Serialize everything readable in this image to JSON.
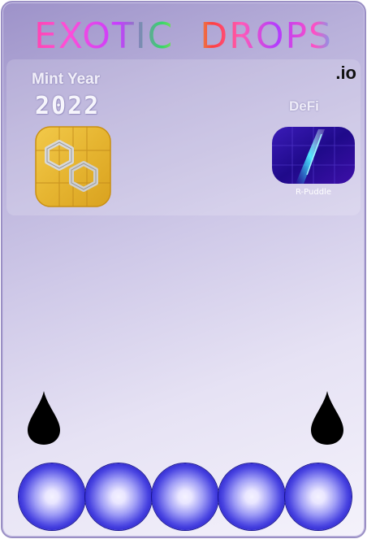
{
  "brand": {
    "title": "EXOTIC  DROPS",
    "tld": ".io"
  },
  "mint": {
    "label": "Mint Year",
    "year": "2022"
  },
  "category": {
    "label": "DeFi"
  },
  "project": {
    "name": "R-Puddle"
  },
  "icons": {
    "left_badge": "polygon-chip-icon",
    "right_badge": "r-puddle-icon",
    "drops": [
      "droplet-icon",
      "droplet-icon"
    ],
    "orbs": [
      "orb-icon",
      "orb-icon",
      "orb-icon",
      "orb-icon",
      "orb-icon"
    ]
  },
  "colors": {
    "card_top": "#9d92c9",
    "card_bottom": "#f4f2fb",
    "orb_core": "#f4f2ff",
    "orb_edge": "#14108c",
    "chip_gold": "#e8b93a",
    "puddle_purple": "#2b0d9e"
  }
}
